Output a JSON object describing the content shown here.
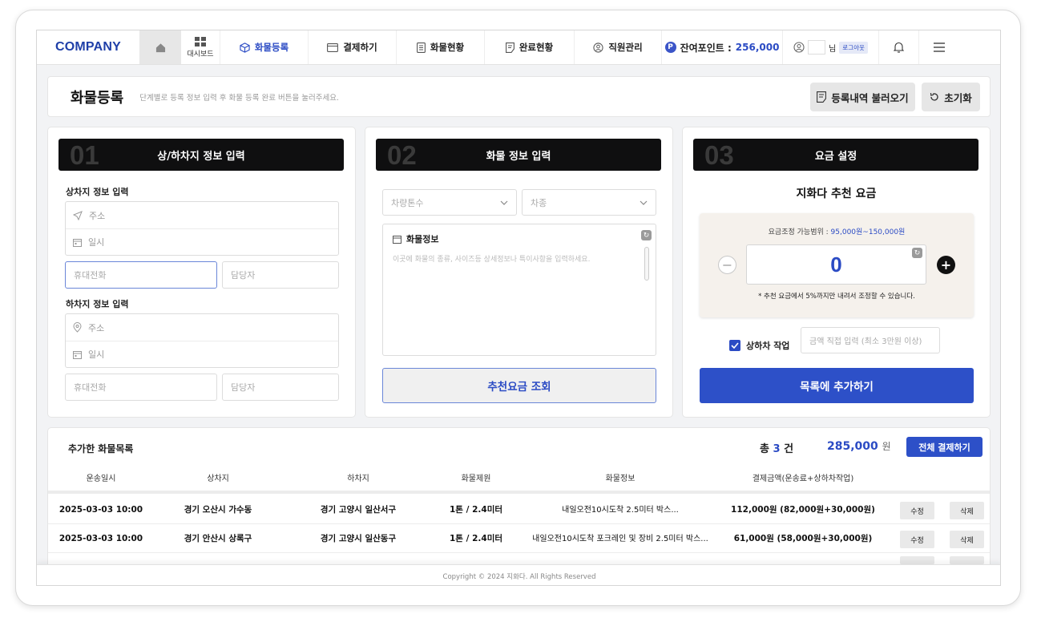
{
  "nav": {
    "logo": "COMPANY",
    "dashboard_label": "대시보드",
    "items": [
      {
        "label": "화물등록",
        "active": true
      },
      {
        "label": "결제하기",
        "active": false
      },
      {
        "label": "화물현황",
        "active": false
      },
      {
        "label": "완료현황",
        "active": false
      },
      {
        "label": "직원관리",
        "active": false
      }
    ],
    "points_label": "잔여포인트 :",
    "points_value": "256,000",
    "points_badge": "P",
    "user_suffix": "님",
    "logout_label": "로그아웃"
  },
  "page": {
    "title": "화물등록",
    "subtitle": "단계별로 등록 정보 입력 후 화물 등록 완료 버튼을 눌러주세요.",
    "load_history_button": "등록내역 불러오기",
    "reset_button": "초기화"
  },
  "step1": {
    "num": "01",
    "title": "상/하차지 정보 입력",
    "pickup_label": "상차지 정보 입력",
    "dropoff_label": "하차지 정보 입력",
    "address_placeholder": "주소",
    "datetime_placeholder": "일시",
    "phone_placeholder": "휴대전화",
    "manager_placeholder": "담당자"
  },
  "step2": {
    "num": "02",
    "title": "화물 정보 입력",
    "tonnage_placeholder": "차량톤수",
    "vehicle_type_placeholder": "차종",
    "cargo_info_label": "화물정보",
    "cargo_info_placeholder": "이곳에 화물의 종류, 사이즈등 상세정보나 특이사항을 입력하세요.",
    "lookup_button": "추천요금 조회"
  },
  "step3": {
    "num": "03",
    "title": "요금 설정",
    "recommend_title": "지화다 추천 요금",
    "range_label": "요금조정 가능범위 :",
    "range_value": "95,000원~150,000원",
    "fee_value": "0",
    "note": "* 추천 요금에서 5%까지만 내려서 조정할 수 있습니다.",
    "loading_work_label": "상하차 작업",
    "loading_work_checked": true,
    "direct_amount_placeholder": "금액 직접 입력 (최소 3만원 이상)",
    "add_button": "목록에 추가하기"
  },
  "list": {
    "title": "추가한 화물목록",
    "total_prefix": "총",
    "total_count": "3",
    "total_suffix": "건",
    "total_amount": "285,000",
    "total_unit": "원",
    "pay_all_button": "전체 결제하기",
    "columns": [
      "운송일시",
      "상차지",
      "하차지",
      "화물제원",
      "화물정보",
      "결제금액(운송료+상하차작업)"
    ],
    "rows": [
      {
        "date": "2025-03-03 10:00",
        "pickup": "경기 오산시 가수동",
        "dropoff": "경기 고양시 일산서구",
        "spec": "1톤 / 2.4미터",
        "info": "내일오전10시도착  2.5미터 박스...",
        "amount": "112,000원 (82,000원+30,000원)",
        "edit": "수정",
        "delete": "삭제"
      },
      {
        "date": "2025-03-03 10:00",
        "pickup": "경기 안산시 상록구",
        "dropoff": "경기 고양시 일산동구",
        "spec": "1톤 / 2.4미터",
        "info": "내일오전10시도착 포크레인 및 장비 2.5미터 박스...",
        "amount": "61,000원 (58,000원+30,000원)",
        "edit": "수정",
        "delete": "삭제"
      }
    ]
  },
  "footer": {
    "copyright": "Copyright © 2024 지화다. All Rights Reserved"
  }
}
